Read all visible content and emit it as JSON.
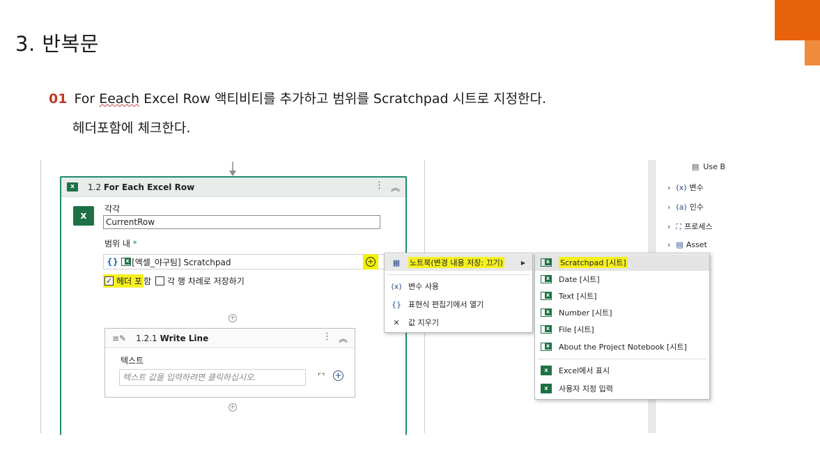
{
  "slide": {
    "title": "3. 반복문",
    "step_number": "01",
    "step_text_pre": "For ",
    "step_text_squiggle": "Eeach",
    "step_text_post": " Excel Row 액티비티를 추가하고 범위를 Scratchpad 시트로 지정한다.",
    "step_text_line2": "헤더포함에 체크한다."
  },
  "activity": {
    "id_label": "1.2",
    "title": "For Each Excel Row",
    "header_icon": "excel-icon",
    "icon_letter": "x",
    "each_label": "각각",
    "each_value": "CurrentRow",
    "scope_label": "범위 내",
    "scope_required": "*",
    "scope_brace": "{}",
    "scope_value": "[엑셀_야구팀] Scratchpad",
    "header_checkbox_label_hl": "헤더 포",
    "header_checkbox_label_rest": "함",
    "header_checked": true,
    "row_order_label": "각 행 차례로 저장하기",
    "row_order_checked": false,
    "more_glyph": "⋮",
    "collapse_glyph": "︽",
    "plus_glyph": "+"
  },
  "inner_activity": {
    "id_label": "1.2.1",
    "title": "Write Line",
    "text_label": "텍스트",
    "text_placeholder": "텍스트 값을 입력하려면 클릭하십시오."
  },
  "menu_primary": {
    "items": [
      {
        "label": "노트북(변경 내용 저장: 끄기)",
        "icon": "notebook-icon",
        "highlighted": true,
        "has_submenu": true
      },
      {
        "label": "변수 사용",
        "icon": "variable-icon",
        "symbol": "(x)"
      },
      {
        "label": "표현식 편집기에서 열기",
        "icon": "braces-icon",
        "symbol": "{}"
      },
      {
        "label": "값 지우기",
        "icon": "clear-icon",
        "symbol": "✕"
      }
    ]
  },
  "menu_secondary": {
    "items": [
      {
        "label": "Scratchpad [시트]",
        "highlighted": true
      },
      {
        "label": "Date [시트]"
      },
      {
        "label": "Text [시트]"
      },
      {
        "label": "Number [시트]"
      },
      {
        "label": "File [시트]"
      },
      {
        "label": "About the Project Notebook [시트]"
      },
      {
        "label": "Excel에서 표시"
      },
      {
        "label": "사용자 지정 입력"
      }
    ]
  },
  "right_panel": {
    "items": [
      {
        "label": "Use B",
        "symbol": ""
      },
      {
        "label": "변수",
        "symbol": "(x)"
      },
      {
        "label": "인수",
        "symbol": "(a)"
      },
      {
        "label": "프로세스",
        "symbol": "⛶"
      },
      {
        "label": "Asset",
        "symbol": "▤"
      }
    ]
  },
  "colors": {
    "accent_orange": "#e8620e",
    "activity_border": "#1f8a70",
    "highlight_yellow": "#f5f020",
    "excel_green": "#1e7145"
  }
}
